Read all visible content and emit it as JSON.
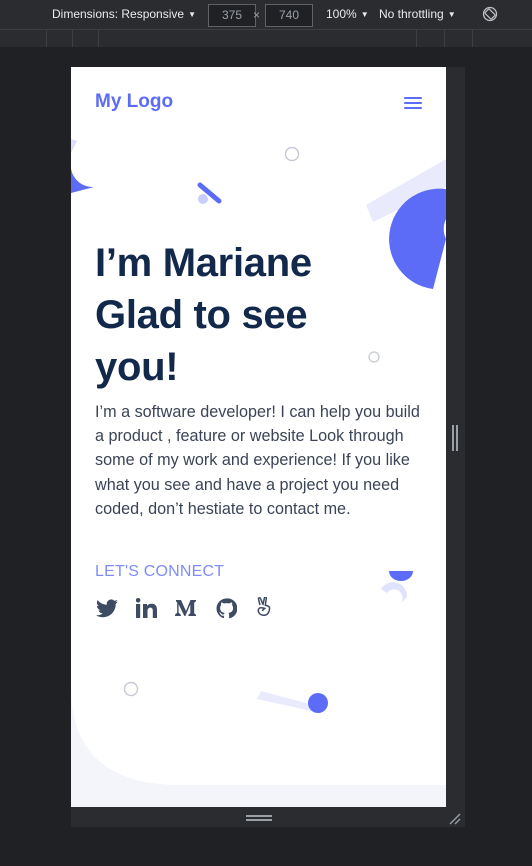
{
  "devtools": {
    "dimensions_label": "Dimensions: Responsive",
    "width": "375",
    "height": "740",
    "times": "×",
    "zoom": "100%",
    "throttling": "No throttling",
    "caret": "▼"
  },
  "page": {
    "logo": "My Logo",
    "title_line1": "I’m Mariane",
    "title_line2": "Glad to see",
    "title_line3": "you!",
    "intro": "I’m a software developer! I can help you build a product , feature or website Look through some of my work and experience! If you like what you see and have a project you need coded, don’t hestiate to contact me.",
    "connect_label": "LET'S CONNECT",
    "social_icons": [
      "twitter-icon",
      "linkedin-icon",
      "medium-icon",
      "github-icon",
      "angellist-icon"
    ]
  },
  "colors": {
    "accent": "#5c6cf6",
    "accent_light": "#e9ebfd",
    "heading": "#13294b",
    "body_text": "#3b4456",
    "icon": "#3d4b63"
  }
}
